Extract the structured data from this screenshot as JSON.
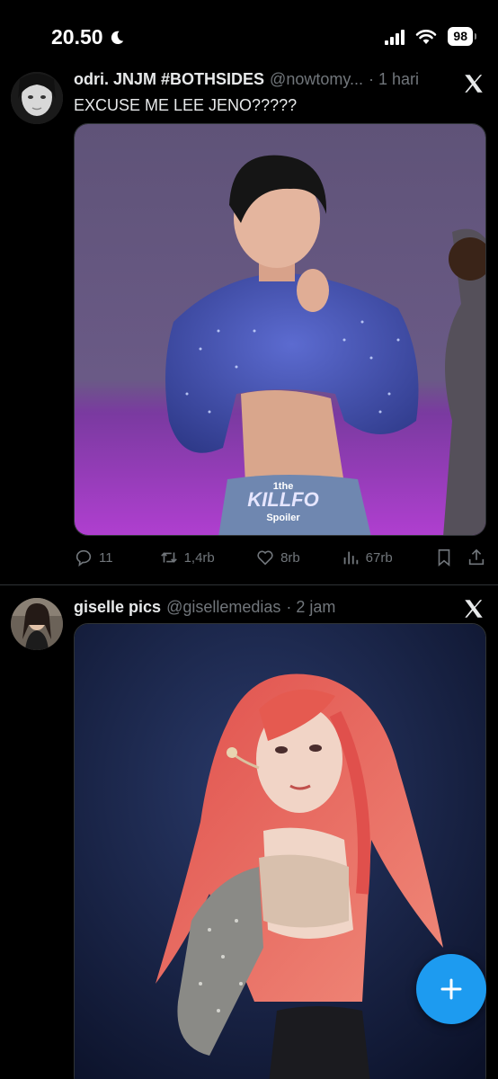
{
  "status_bar": {
    "time": "20.50",
    "battery": "98"
  },
  "tweets": [
    {
      "name": "odri. JNJM #BOTHSIDES",
      "handle": "@nowtomy...",
      "time": "· 1 hari",
      "text": "EXCUSE ME LEE JENO?????",
      "media_caption_line1": "1the",
      "media_caption_line2": "KILLFO",
      "media_caption_line3": "Spoiler",
      "replies": "11",
      "retweets": "1,4rb",
      "likes": "8rb",
      "views": "67rb"
    },
    {
      "name": "giselle pics",
      "handle": "@gisellemedias",
      "time": "· 2 jam"
    }
  ],
  "colors": {
    "accent": "#1d9bf0",
    "muted": "#71767b",
    "background": "#000000"
  },
  "icons": [
    "moon-icon",
    "signal-icon",
    "wifi-icon",
    "x-logo-icon",
    "reply-icon",
    "retweet-icon",
    "like-icon",
    "views-icon",
    "bookmark-icon",
    "share-icon",
    "plus-icon"
  ]
}
